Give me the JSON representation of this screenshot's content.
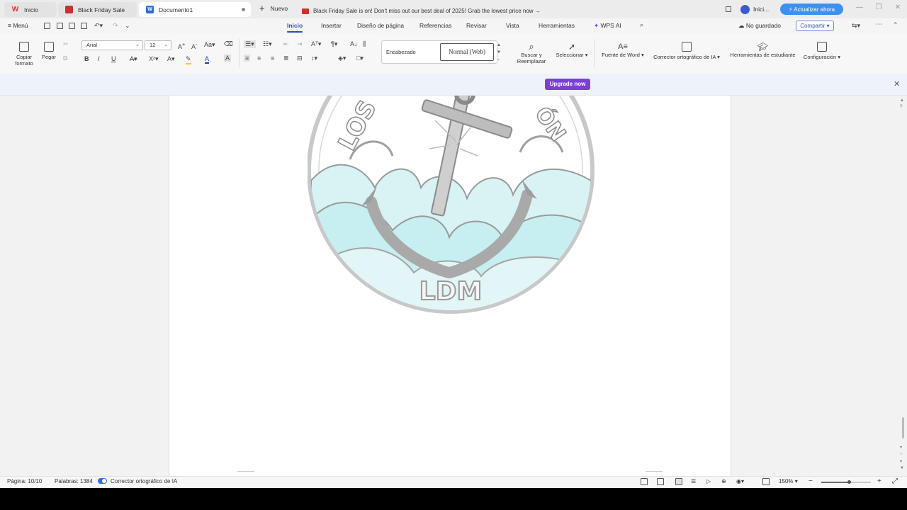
{
  "tabs": [
    {
      "label": "Inicio",
      "icon": "wps-logo-icon"
    },
    {
      "label": "Black Friday Sale",
      "icon": "gift-icon"
    },
    {
      "label": "Documento1",
      "icon": "word-doc-icon",
      "active": true
    }
  ],
  "new_tab_label": "Nuevo",
  "user": {
    "label": "Inici..."
  },
  "upgrade_top_label": "⚡ Actualizar ahora",
  "menu": {
    "menu_label": "Menú",
    "tabs": [
      "Inicio",
      "Insertar",
      "Diseño de página",
      "Referencias",
      "Revisar",
      "Vista",
      "Herramientas",
      "WPS AI"
    ],
    "active_tab": "Inicio",
    "save_status": "No guardado",
    "share_label": "Compartir"
  },
  "ribbon": {
    "copy_format": "Copiar formato",
    "paste": "Pegar",
    "font_name": "Arial",
    "font_size": "12",
    "bold": "B",
    "italic": "I",
    "underline": "U",
    "style_heading": "Encabezado",
    "style_normal": "Normal (Web)",
    "find_replace": "Buscar y Reemplazar",
    "select": "Seleccionar",
    "word_font": "Fuente de Word",
    "ai_spell": "Corrector ortográfico de IA",
    "student_tools": "Herramientas de estudiante",
    "settings": "Configuración"
  },
  "banner": {
    "text": "Black Friday Sale is on! Don't miss out our best deal of 2025! Grab the lowest price now →",
    "button": "Upgrade now"
  },
  "document": {
    "logo_text": "LDM",
    "logo_ring_left": "LOS",
    "logo_ring_right": "ÓN"
  },
  "status": {
    "page": "Página: 10/10",
    "words": "Palabras: 1384",
    "ai_spell": "Corrector ortográfico de IA",
    "zoom": "150%",
    "zoom_level": 0.55
  },
  "colors": {
    "accent": "#1e56c8",
    "upgrade_top": "#3d8ff2",
    "upgrade_now": "#7a3fd6",
    "wps_red": "#d9322b"
  }
}
